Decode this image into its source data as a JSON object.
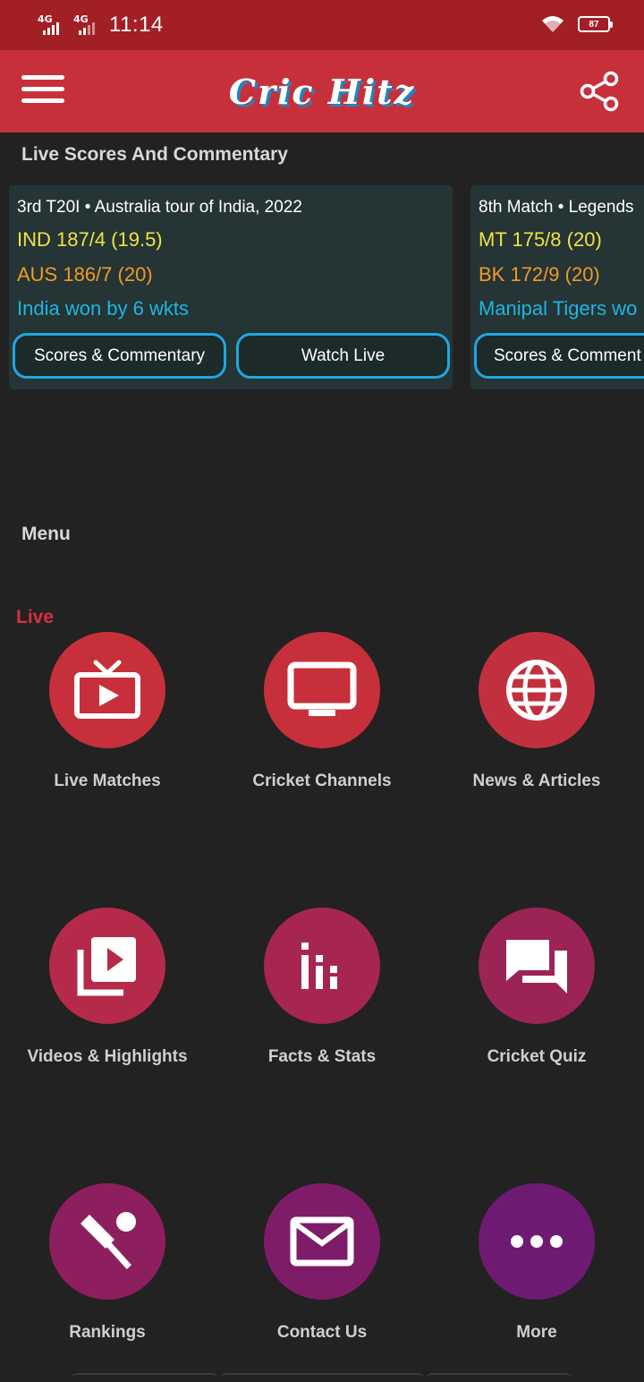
{
  "status_bar": {
    "network_1": "4G",
    "network_2": "4G",
    "time": "11:14",
    "battery": "87",
    "icons": [
      "signal-icon",
      "wifi-icon",
      "battery-icon"
    ]
  },
  "app_bar": {
    "logo_text": "Cric Hitz",
    "menu_icon": "hamburger-menu-icon",
    "share_icon": "share-icon"
  },
  "live_section": {
    "title": "Live Scores And Commentary",
    "cards": [
      {
        "series": "3rd T20I • Australia tour of India, 2022",
        "team1": "IND 187/4 (19.5)",
        "team2": "AUS 186/7 (20)",
        "result": "India won by 6 wkts",
        "button1": "Scores & Commentary",
        "button2": "Watch Live"
      },
      {
        "series": "8th Match • Legends",
        "team1": "MT 175/8 (20)",
        "team2": "BK 172/9 (20)",
        "result": "Manipal Tigers wo",
        "button1": "Scores & Comment"
      }
    ]
  },
  "menu_section": {
    "title": "Menu",
    "live_label": "Live",
    "items": [
      {
        "label": "Live Matches",
        "icon": "live-tv-icon",
        "color": "#c7303a"
      },
      {
        "label": "Cricket Channels",
        "icon": "monitor-icon",
        "color": "#c7303a"
      },
      {
        "label": "News & Articles",
        "icon": "globe-icon",
        "color": "#c2303f"
      },
      {
        "label": "Videos & Highlights",
        "icon": "video-library-icon",
        "color": "#b52a4a"
      },
      {
        "label": "Facts & Stats",
        "icon": "stats-bars-icon",
        "color": "#a6264f"
      },
      {
        "label": "Cricket Quiz",
        "icon": "chat-bubbles-icon",
        "color": "#9c2356"
      },
      {
        "label": "Rankings",
        "icon": "cricket-bat-ball-icon",
        "color": "#8e1f5e"
      },
      {
        "label": "Contact Us",
        "icon": "mail-icon",
        "color": "#7f1c69"
      },
      {
        "label": "More",
        "icon": "more-dots-icon",
        "color": "#6e1a73"
      }
    ]
  },
  "colors": {
    "status_bar": "#a21f25",
    "app_bar": "#c7303a",
    "background": "#222222",
    "card": "#253434",
    "team1_score": "#f2e33e",
    "team2_score": "#ef9a2a",
    "result": "#1fb6e1",
    "button_border": "#1fa7df"
  }
}
